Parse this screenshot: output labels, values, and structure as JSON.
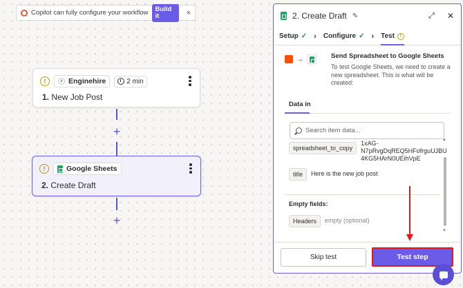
{
  "copilot": {
    "message": "Copilot can fully configure your workflow",
    "build_label": "Build it",
    "close_label": "×"
  },
  "steps": [
    {
      "app": "Enginehire",
      "app_logo_letter": "e",
      "duration": "2 min",
      "number": "1.",
      "title": "New Job Post",
      "status": "warning"
    },
    {
      "app": "Google Sheets",
      "number": "2.",
      "title": "Create Draft",
      "status": "warning"
    }
  ],
  "plus_symbol": "+",
  "warn_symbol": "!",
  "panel": {
    "title": "2. Create Draft",
    "tabs": [
      {
        "label": "Setup",
        "status": "complete"
      },
      {
        "label": "Configure",
        "status": "complete"
      },
      {
        "label": "Test",
        "status": "warning"
      }
    ],
    "send_title": "Send Spreadsheet to Google Sheets",
    "send_description": "To test Google Sheets, we need to create a new spreadsheet. This is what will be created:",
    "data_in_label": "Data in",
    "search_placeholder": "Search item data...",
    "fields": [
      {
        "key": "spreadsheet_to_copy",
        "value_line1": "1xAG-",
        "value_line2": "N7pRvgDqREQ5HFofrguUJBU",
        "value_line3": "4KG5HArN0UEihVpE"
      },
      {
        "key": "title",
        "value_line1": "Here is the new job post"
      }
    ],
    "empty_fields_label": "Empty fields:",
    "empty_fields": [
      {
        "key": "Headers",
        "value": "empty (optional)"
      }
    ],
    "skip_label": "Skip test",
    "test_label": "Test step"
  },
  "colors": {
    "accent": "#6b5ce7",
    "highlight_red": "#e01818",
    "sheets_green": "#1fa463",
    "zapier_orange": "#ff4f00"
  }
}
